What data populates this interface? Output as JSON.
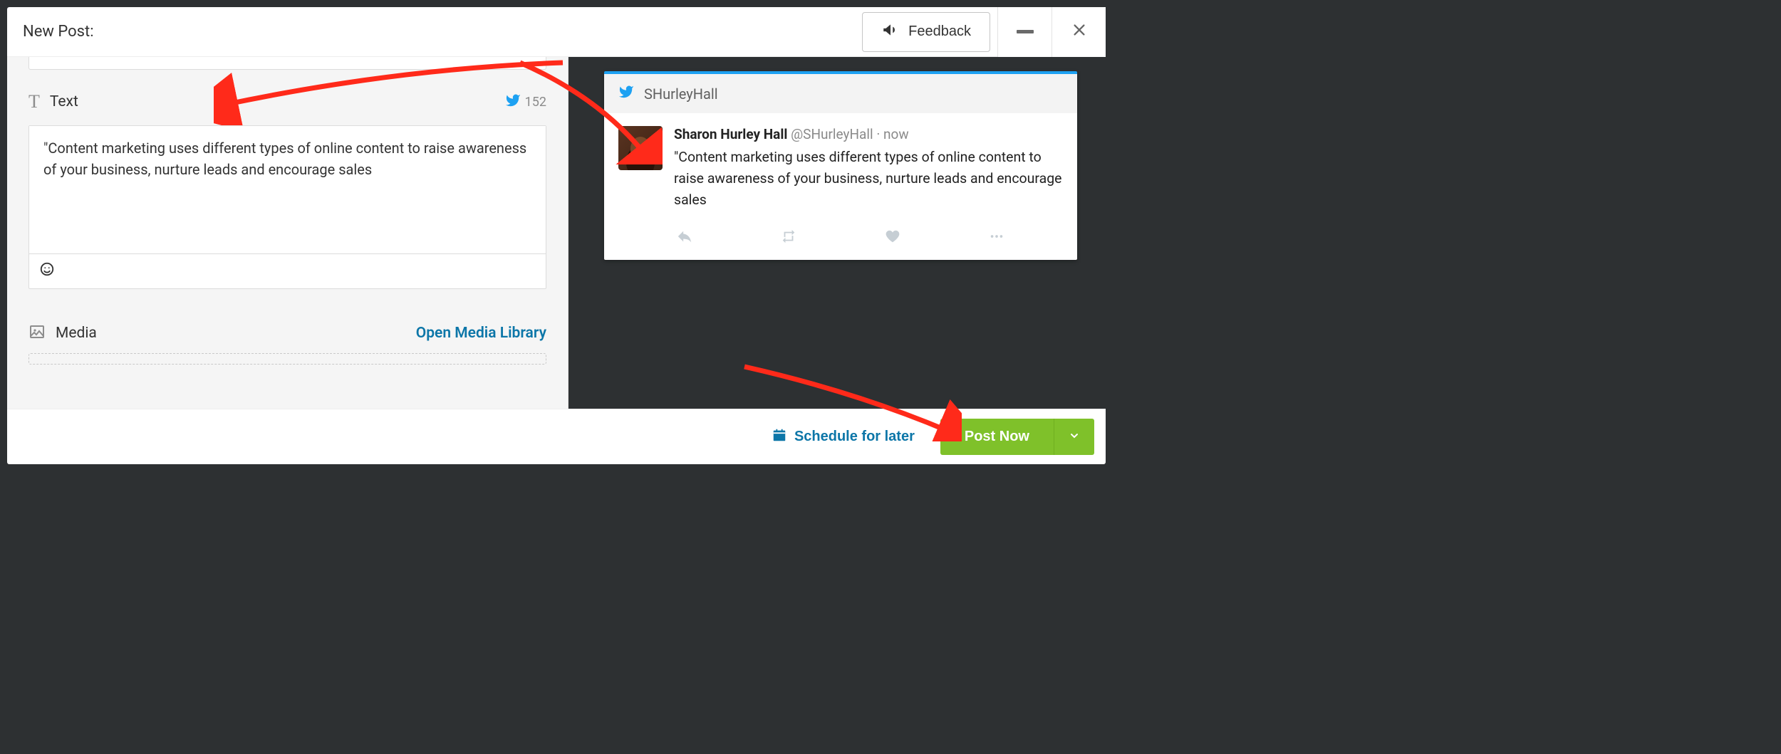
{
  "header": {
    "title": "New Post:",
    "feedback_label": "Feedback"
  },
  "composer": {
    "text_section_label": "Text",
    "char_count": "152",
    "text_value": "\"Content marketing uses different types of online content to raise awareness of your business, nurture leads and encourage sales",
    "media_section_label": "Media",
    "open_media_label": "Open Media Library"
  },
  "preview": {
    "account_handle": "SHurleyHall",
    "display_name": "Sharon Hurley Hall",
    "at_handle": "@SHurleyHall",
    "timestamp": "now",
    "tweet_text": "\"Content marketing uses different types of online content to raise awareness of your business, nurture leads and encourage sales"
  },
  "footer": {
    "schedule_label": "Schedule for later",
    "post_label": "Post Now"
  }
}
